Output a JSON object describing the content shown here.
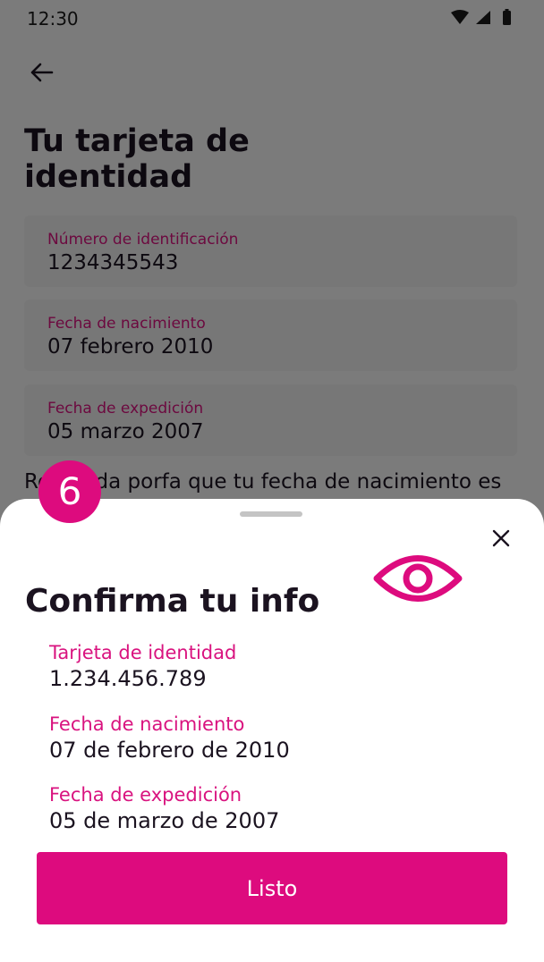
{
  "status_bar": {
    "time": "12:30",
    "icons": [
      "wifi-icon",
      "signal-icon",
      "battery-icon"
    ]
  },
  "screen": {
    "title": "Tu tarjeta de identidad",
    "fields": [
      {
        "label": "Número de identificación",
        "value": "1234345543"
      },
      {
        "label": "Fecha de nacimiento",
        "value": "07 febrero 2010"
      },
      {
        "label": "Fecha de expedición",
        "value": "05 marzo 2007"
      }
    ],
    "hint": "Recuerda porfa que tu fecha de nacimiento es"
  },
  "step_badge": "6",
  "sheet": {
    "title": "Confirma tu info",
    "items": [
      {
        "label": "Tarjeta de identidad",
        "value": "1.234.456.789"
      },
      {
        "label": "Fecha de nacimiento",
        "value": "07 de febrero de 2010"
      },
      {
        "label": "Fecha de expedición",
        "value": "05 de marzo de 2007"
      }
    ],
    "button_label": "Listo"
  },
  "colors": {
    "accent": "#dd0b7e",
    "text": "#1b1320",
    "scrim": "rgba(0,0,0,0.5)"
  }
}
